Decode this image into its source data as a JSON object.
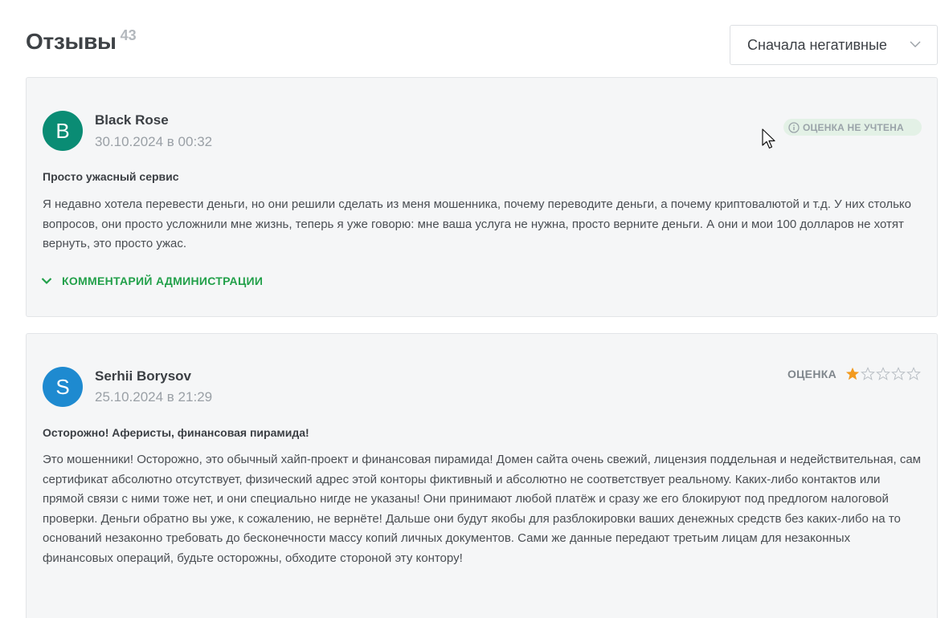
{
  "header": {
    "title": "Отзывы",
    "count": "43"
  },
  "sort": {
    "selected": "Сначала негативные",
    "icon": "chevron-down-icon"
  },
  "reviews": [
    {
      "avatar_letter": "B",
      "avatar_color": "#0a8c74",
      "author": "Black Rose",
      "date": "30.10.2024 в 00:32",
      "status_badge": "ОЦЕНКА НЕ УЧТЕНА",
      "status_icon": "info-icon",
      "title": "Просто ужасный сервис",
      "text": "Я недавно хотела перевести деньги, но они решили сделать из меня мошенника, почему переводите деньги, а почему криптовалютой и т.д. У них столько вопросов, они просто усложнили мне жизнь, теперь я уже говорю: мне ваша услуга не нужна, просто верните деньги. А они и мои 100 долларов не хотят вернуть, это просто ужас.",
      "admin_comment_label": "КОММЕНТАРИЙ АДМИНИСТРАЦИИ"
    },
    {
      "avatar_letter": "S",
      "avatar_color": "#1e8ad0",
      "author": "Serhii Borysov",
      "date": "25.10.2024 в 21:29",
      "rating_label": "ОЦЕНКА",
      "rating": 1,
      "rating_max": 5,
      "title": "Осторожно! Аферисты, финансовая пирамида!",
      "text": "Это мошенники! Осторожно, это обычный хайп-проект и финансовая пирамида! Домен сайта очень свежий, лицензия поддельная и недействительная, сам сертификат абсолютно отсутствует, физический адрес этой конторы фиктивный и абсолютно не соответствует реальному. Каких-либо контактов или прямой связи с ними тоже нет, и они специально нигде не указаны! Они принимают любой платёж и сразу же его блокируют под предлогом налоговой проверки. Деньги обратно вы уже, к сожалению, не вернёте! Дальше они будут якобы для разблокировки ваших денежных средств без каких-либо на то оснований незаконно требовать до бесконечности массу копий личных документов. Сами же данные передают третьим лицам для незаконных финансовых операций, будьте осторожны, обходите стороной эту контору!"
    }
  ],
  "colors": {
    "accent_green": "#22a04a",
    "star_filled": "#f29a1f",
    "star_empty": "#b8bec4"
  }
}
